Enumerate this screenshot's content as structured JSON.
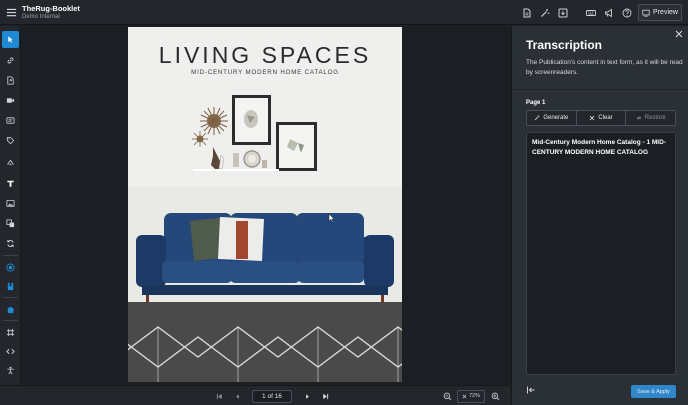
{
  "app": {
    "title": "TheRug-Booklet",
    "subtitle": "Demo Internal",
    "preview_label": "Preview"
  },
  "top_icons": [
    "document-icon",
    "magic-wand-icon",
    "download-icon",
    "keyboard-icon",
    "megaphone-icon",
    "help-icon"
  ],
  "left_tools": [
    "pointer-icon",
    "link-icon",
    "export-icon",
    "video-icon",
    "caption-icon",
    "tag-icon",
    "drop-icon",
    "text-icon",
    "image-icon",
    "layers-icon",
    "refresh-icon",
    "plus-circle-icon",
    "bookmark-icon",
    "puzzle-icon",
    "frame-icon",
    "code-icon",
    "accessibility-icon"
  ],
  "page_content": {
    "headline": "LIVING SPACES",
    "subheadline": "MID-CENTURY MODERN HOME CATALOG"
  },
  "pager": {
    "value": "1 of 16"
  },
  "zoom": {
    "level": "72%"
  },
  "panel": {
    "title": "Transcription",
    "description": "The Publication's content in text form, as it will be read by screenreaders.",
    "page_label": "Page 1",
    "buttons": {
      "generate": "Generate",
      "clear": "Clear",
      "restore": "Restore"
    },
    "transcription_text": "Mid-Century Modern Home Catalog - 1 MID-CENTURY MODERN HOME CATALOG",
    "save_label": "Save & Apply"
  },
  "colors": {
    "accent": "#1f8ad4",
    "sofa": "#1f3f6e",
    "background": "#1e2227",
    "panel": "#2b3036"
  }
}
